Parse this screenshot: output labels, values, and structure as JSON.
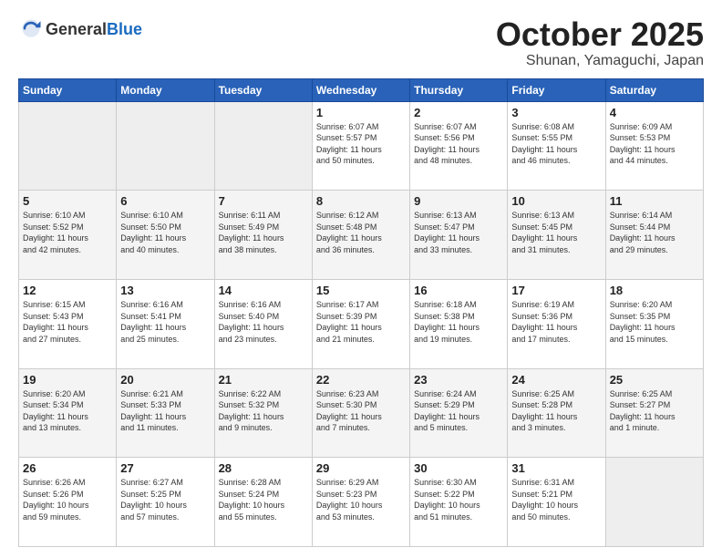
{
  "header": {
    "logo": {
      "general": "General",
      "blue": "Blue"
    },
    "month": "October 2025",
    "location": "Shunan, Yamaguchi, Japan"
  },
  "days_of_week": [
    "Sunday",
    "Monday",
    "Tuesday",
    "Wednesday",
    "Thursday",
    "Friday",
    "Saturday"
  ],
  "weeks": [
    [
      {
        "day": "",
        "info": ""
      },
      {
        "day": "",
        "info": ""
      },
      {
        "day": "",
        "info": ""
      },
      {
        "day": "1",
        "info": "Sunrise: 6:07 AM\nSunset: 5:57 PM\nDaylight: 11 hours\nand 50 minutes."
      },
      {
        "day": "2",
        "info": "Sunrise: 6:07 AM\nSunset: 5:56 PM\nDaylight: 11 hours\nand 48 minutes."
      },
      {
        "day": "3",
        "info": "Sunrise: 6:08 AM\nSunset: 5:55 PM\nDaylight: 11 hours\nand 46 minutes."
      },
      {
        "day": "4",
        "info": "Sunrise: 6:09 AM\nSunset: 5:53 PM\nDaylight: 11 hours\nand 44 minutes."
      }
    ],
    [
      {
        "day": "5",
        "info": "Sunrise: 6:10 AM\nSunset: 5:52 PM\nDaylight: 11 hours\nand 42 minutes."
      },
      {
        "day": "6",
        "info": "Sunrise: 6:10 AM\nSunset: 5:50 PM\nDaylight: 11 hours\nand 40 minutes."
      },
      {
        "day": "7",
        "info": "Sunrise: 6:11 AM\nSunset: 5:49 PM\nDaylight: 11 hours\nand 38 minutes."
      },
      {
        "day": "8",
        "info": "Sunrise: 6:12 AM\nSunset: 5:48 PM\nDaylight: 11 hours\nand 36 minutes."
      },
      {
        "day": "9",
        "info": "Sunrise: 6:13 AM\nSunset: 5:47 PM\nDaylight: 11 hours\nand 33 minutes."
      },
      {
        "day": "10",
        "info": "Sunrise: 6:13 AM\nSunset: 5:45 PM\nDaylight: 11 hours\nand 31 minutes."
      },
      {
        "day": "11",
        "info": "Sunrise: 6:14 AM\nSunset: 5:44 PM\nDaylight: 11 hours\nand 29 minutes."
      }
    ],
    [
      {
        "day": "12",
        "info": "Sunrise: 6:15 AM\nSunset: 5:43 PM\nDaylight: 11 hours\nand 27 minutes."
      },
      {
        "day": "13",
        "info": "Sunrise: 6:16 AM\nSunset: 5:41 PM\nDaylight: 11 hours\nand 25 minutes."
      },
      {
        "day": "14",
        "info": "Sunrise: 6:16 AM\nSunset: 5:40 PM\nDaylight: 11 hours\nand 23 minutes."
      },
      {
        "day": "15",
        "info": "Sunrise: 6:17 AM\nSunset: 5:39 PM\nDaylight: 11 hours\nand 21 minutes."
      },
      {
        "day": "16",
        "info": "Sunrise: 6:18 AM\nSunset: 5:38 PM\nDaylight: 11 hours\nand 19 minutes."
      },
      {
        "day": "17",
        "info": "Sunrise: 6:19 AM\nSunset: 5:36 PM\nDaylight: 11 hours\nand 17 minutes."
      },
      {
        "day": "18",
        "info": "Sunrise: 6:20 AM\nSunset: 5:35 PM\nDaylight: 11 hours\nand 15 minutes."
      }
    ],
    [
      {
        "day": "19",
        "info": "Sunrise: 6:20 AM\nSunset: 5:34 PM\nDaylight: 11 hours\nand 13 minutes."
      },
      {
        "day": "20",
        "info": "Sunrise: 6:21 AM\nSunset: 5:33 PM\nDaylight: 11 hours\nand 11 minutes."
      },
      {
        "day": "21",
        "info": "Sunrise: 6:22 AM\nSunset: 5:32 PM\nDaylight: 11 hours\nand 9 minutes."
      },
      {
        "day": "22",
        "info": "Sunrise: 6:23 AM\nSunset: 5:30 PM\nDaylight: 11 hours\nand 7 minutes."
      },
      {
        "day": "23",
        "info": "Sunrise: 6:24 AM\nSunset: 5:29 PM\nDaylight: 11 hours\nand 5 minutes."
      },
      {
        "day": "24",
        "info": "Sunrise: 6:25 AM\nSunset: 5:28 PM\nDaylight: 11 hours\nand 3 minutes."
      },
      {
        "day": "25",
        "info": "Sunrise: 6:25 AM\nSunset: 5:27 PM\nDaylight: 11 hours\nand 1 minute."
      }
    ],
    [
      {
        "day": "26",
        "info": "Sunrise: 6:26 AM\nSunset: 5:26 PM\nDaylight: 10 hours\nand 59 minutes."
      },
      {
        "day": "27",
        "info": "Sunrise: 6:27 AM\nSunset: 5:25 PM\nDaylight: 10 hours\nand 57 minutes."
      },
      {
        "day": "28",
        "info": "Sunrise: 6:28 AM\nSunset: 5:24 PM\nDaylight: 10 hours\nand 55 minutes."
      },
      {
        "day": "29",
        "info": "Sunrise: 6:29 AM\nSunset: 5:23 PM\nDaylight: 10 hours\nand 53 minutes."
      },
      {
        "day": "30",
        "info": "Sunrise: 6:30 AM\nSunset: 5:22 PM\nDaylight: 10 hours\nand 51 minutes."
      },
      {
        "day": "31",
        "info": "Sunrise: 6:31 AM\nSunset: 5:21 PM\nDaylight: 10 hours\nand 50 minutes."
      },
      {
        "day": "",
        "info": ""
      }
    ]
  ]
}
